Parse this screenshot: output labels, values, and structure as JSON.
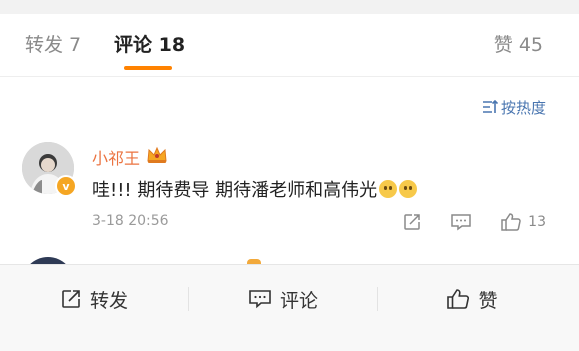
{
  "tabs": {
    "repost": "转发 7",
    "comment": "评论 18",
    "like": "赞 45"
  },
  "sort": {
    "label": "按热度",
    "icon": "sort-icon"
  },
  "comment": {
    "username": "小祁王",
    "text_part1": "哇!!! 期待费导 期待潘老师和高伟光",
    "timestamp": "3-18 20:56",
    "like_count": "13",
    "badge_letter": "v"
  },
  "bottom_bar": {
    "repost": "转发",
    "comment": "评论",
    "like": "赞"
  },
  "colors": {
    "accent": "#ff8200",
    "username": "#eb7340",
    "link": "#4a76b0"
  }
}
